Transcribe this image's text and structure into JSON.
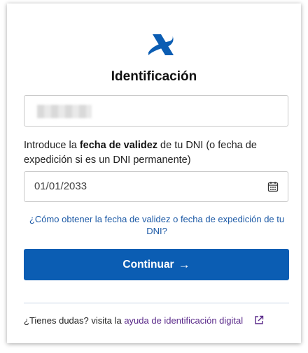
{
  "title": "Identificación",
  "id_field": {
    "value_redacted": true
  },
  "instructions": {
    "prefix": "Introduce la ",
    "bold": "fecha de validez",
    "suffix": " de tu DNI (o fecha de expedición si es un DNI permanente)"
  },
  "date_field": {
    "value": "01/01/2033"
  },
  "help_link": "¿Cómo obtener la fecha de validez o fecha de expedición de tu DNI?",
  "button": {
    "label": "Continuar",
    "arrow": "→"
  },
  "footer": {
    "text": "¿Tienes dudas? visita la ",
    "link": "ayuda de identificación digital"
  },
  "colors": {
    "primary": "#0b5db3",
    "link": "#1d5aa6",
    "visited_link": "#5a2a8a"
  },
  "icons": [
    "agencia-tributaria-logo",
    "calendar-icon",
    "external-link-icon",
    "arrow-right-icon"
  ]
}
